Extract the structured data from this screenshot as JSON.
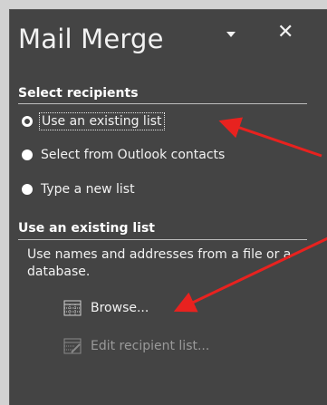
{
  "pane": {
    "title": "Mail Merge",
    "close_glyph": "✕"
  },
  "select_recipients": {
    "heading": "Select recipients",
    "options": [
      {
        "label": "Use an existing list",
        "selected": true
      },
      {
        "label": "Select from Outlook contacts",
        "selected": false
      },
      {
        "label": "Type a new list",
        "selected": false
      }
    ]
  },
  "existing_list": {
    "heading": "Use an existing list",
    "description": "Use names and addresses from a file or a database.",
    "browse_label": "Browse...",
    "edit_label": "Edit recipient list..."
  },
  "colors": {
    "pane_bg": "#444444",
    "text": "#f2f2f2",
    "disabled_text": "#9a9a9a",
    "annotation_arrow": "#e8221f"
  },
  "icons": {
    "options": "dropdown-triangle-icon",
    "close": "close-icon",
    "browse": "table-grid-icon",
    "edit": "edit-list-icon"
  }
}
